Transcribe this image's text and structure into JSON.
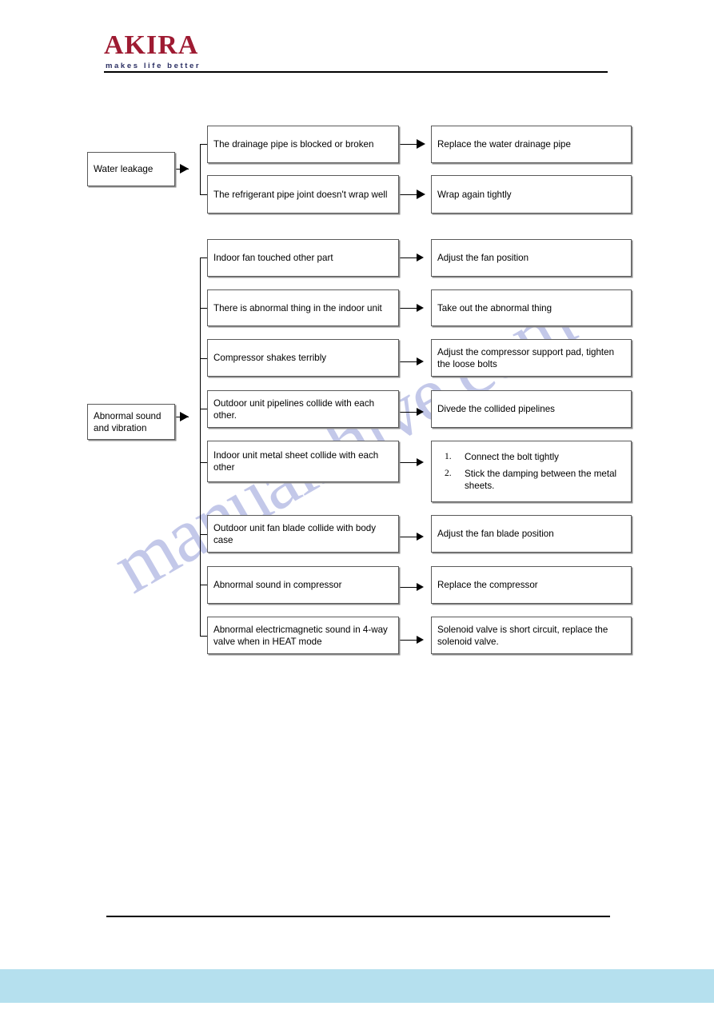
{
  "brand": {
    "name": "AKIRA",
    "tagline": "makes life better"
  },
  "watermark": {
    "text": "manualshive.com"
  },
  "diagram": {
    "type": "troubleshooting-flowchart",
    "groups": [
      {
        "id": "water-leakage",
        "symptom": "Water leakage",
        "rows": [
          {
            "cause": "The drainage pipe is blocked or broken",
            "solution": "Replace the water drainage pipe"
          },
          {
            "cause": "The refrigerant pipe joint doesn't wrap well",
            "solution": "Wrap again tightly"
          }
        ]
      },
      {
        "id": "abnormal-sound-and-vibration",
        "symptom": "Abnormal sound and vibration",
        "symptom_line1": "Abnormal sound",
        "symptom_line2": "and vibration",
        "rows": [
          {
            "cause": "Indoor fan touched other part",
            "solution": "Adjust the fan position"
          },
          {
            "cause": "There is abnormal thing in the indoor unit",
            "solution": "Take out the abnormal thing"
          },
          {
            "cause": "Compressor shakes terribly",
            "solution": "Adjust the compressor support pad, tighten the loose bolts"
          },
          {
            "cause": "Outdoor unit pipelines collide with each other.",
            "solution": "Divede the collided pipelines"
          },
          {
            "cause": "Indoor unit metal sheet collide with each other",
            "solution_list": [
              {
                "num": "1.",
                "text": "Connect the bolt tightly"
              },
              {
                "num": "2.",
                "text": "Stick the damping between the metal sheets."
              }
            ]
          },
          {
            "cause": "Outdoor unit fan blade collide with body case",
            "solution": "Adjust the fan blade position"
          },
          {
            "cause": "Abnormal sound in compressor",
            "solution": "Replace the compressor"
          },
          {
            "cause": "Abnormal electricmagnetic sound in 4-way valve when in HEAT mode",
            "solution": "Solenoid valve is short circuit, replace the solenoid valve."
          }
        ]
      }
    ]
  }
}
